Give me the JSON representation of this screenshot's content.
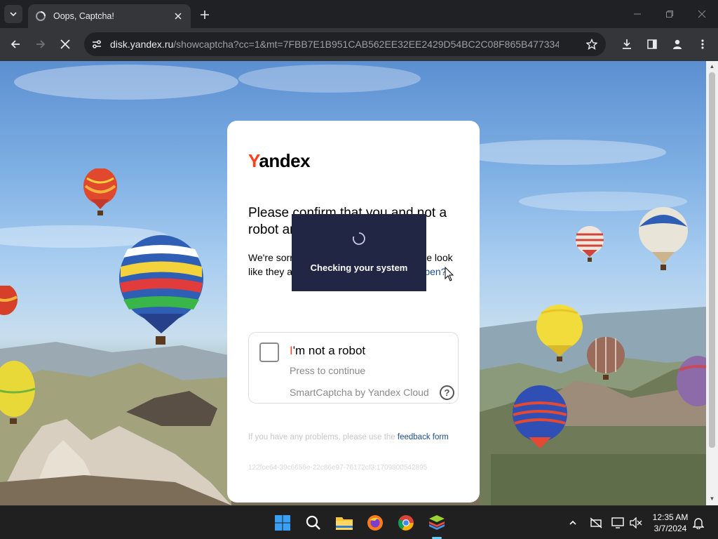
{
  "browser": {
    "tab": {
      "title": "Oops, Captcha!",
      "favicon": "loading-icon"
    },
    "address": {
      "domain": "disk.yandex.ru",
      "path": "/showcaptcha?cc=1&mt=7FBB7E1B951CAB562EE32EE2429D54BC2C08F865B4773347B68B57..."
    },
    "icons": [
      "tab-search-icon",
      "close-icon",
      "plus-icon",
      "minimize-icon",
      "restore-icon",
      "window-close-icon",
      "back-arrow-icon",
      "forward-arrow-icon",
      "stop-icon",
      "site-settings-icon",
      "star-icon",
      "download-icon",
      "side-panel-icon",
      "profile-icon",
      "more-menu-icon"
    ]
  },
  "captcha": {
    "logo": {
      "first_letter": "Y",
      "rest": "andex"
    },
    "heading": "Please confirm that you and not a robot are sending requests",
    "description": {
      "text": "We're sorry, but requests from your device look like they are automatic. ",
      "link": "Why did this happen?"
    },
    "checkbox": {
      "label_first": "I",
      "label_rest": "'m not a robot",
      "sub": "Press to continue",
      "provider": "SmartCaptcha by Yandex Cloud"
    },
    "problems": {
      "text": "If you have any problems, please use the ",
      "link": "feedback form"
    },
    "hash": "122fce64-39c6656e-22c86e97-76172cf3:1709800542895",
    "overlay": {
      "text": "Checking your system"
    }
  },
  "taskbar": {
    "apps": [
      "windows-start-icon",
      "search-icon",
      "file-explorer-icon",
      "firefox-icon",
      "chrome-icon",
      "bluestacks-icon"
    ],
    "tray": [
      "chevron-up-icon",
      "network-off-icon",
      "display-icon",
      "volume-muted-icon",
      "notification-bell-icon"
    ],
    "time": "12:35 AM",
    "date": "3/7/2024"
  },
  "colors": {
    "yandex_red": "#fc3f1d",
    "link_blue": "#1b4e8c",
    "overlay_navy": "#222645"
  }
}
